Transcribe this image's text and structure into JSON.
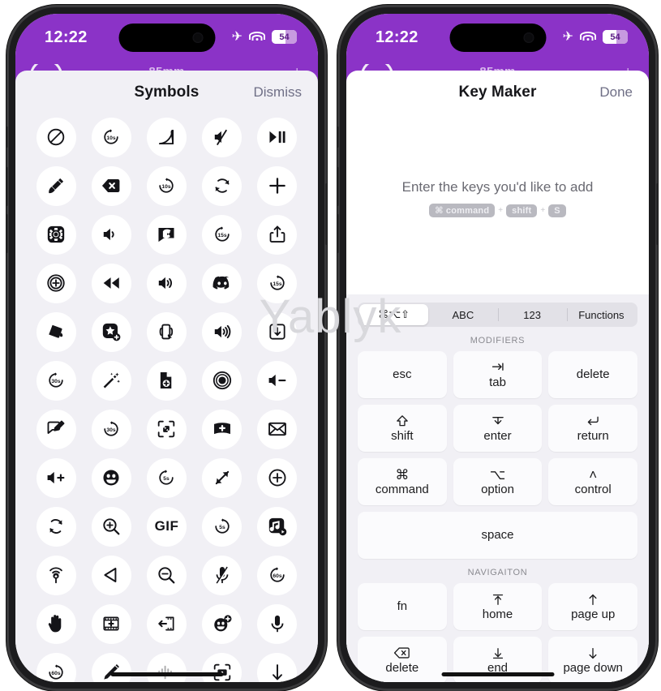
{
  "watermark": "Yablyk",
  "status_bar": {
    "time": "12:22",
    "airplane_icon": "airplane-mode-icon",
    "wifi_icon": "wifi-icon",
    "battery_level": "54",
    "battery_percent": 54,
    "bar_color": "#8B33C7"
  },
  "app_behind": {
    "title": "85mm",
    "back_icon": "circle-icon",
    "right_label": "|"
  },
  "left_phone": {
    "sheet": {
      "title": "Symbols",
      "action_label": "Dismiss"
    },
    "symbols": [
      {
        "name": "slash-circle-icon",
        "label": "nosign"
      },
      {
        "name": "goback-10-seconds-icon",
        "label": "10s"
      },
      {
        "name": "curve-chart-icon",
        "label": "curve"
      },
      {
        "name": "speaker-slash-icon",
        "label": "mute"
      },
      {
        "name": "play-pause-icon",
        "label": "play/pause"
      },
      {
        "name": "pen-plug-icon",
        "label": "pen"
      },
      {
        "name": "delete-left-x-icon",
        "label": "delete"
      },
      {
        "name": "goforward-10-seconds-icon",
        "label": "10s"
      },
      {
        "name": "arrow-triangle-2-circlepath-icon",
        "label": "loop"
      },
      {
        "name": "plus-icon",
        "label": "plus"
      },
      {
        "name": "gearshape-square-icon",
        "label": "settings"
      },
      {
        "name": "speaker-wave-1-icon",
        "label": "volume low"
      },
      {
        "name": "phone-bubble-icon",
        "label": "call bubble"
      },
      {
        "name": "goback-15-seconds-icon",
        "label": "15s"
      },
      {
        "name": "square-and-arrow-up-icon",
        "label": "share"
      },
      {
        "name": "plus-circle-dotted-icon",
        "label": "add circle"
      },
      {
        "name": "backward-fill-icon",
        "label": "rewind"
      },
      {
        "name": "speaker-wave-2-icon",
        "label": "volume mid"
      },
      {
        "name": "discord-icon",
        "label": "discord"
      },
      {
        "name": "goforward-15-seconds-icon",
        "label": "15s"
      },
      {
        "name": "paintbucket-icon",
        "label": "fill"
      },
      {
        "name": "star-square-plus-icon",
        "label": "add favorite"
      },
      {
        "name": "rotate-device-icon",
        "label": "rotate"
      },
      {
        "name": "speaker-wave-3-icon",
        "label": "volume high"
      },
      {
        "name": "square-arrow-down-icon",
        "label": "download"
      },
      {
        "name": "goback-30-seconds-icon",
        "label": "30s"
      },
      {
        "name": "wand-and-stars-icon",
        "label": "magic"
      },
      {
        "name": "doc-badge-plus-icon",
        "label": "new doc"
      },
      {
        "name": "record-circle-icon",
        "label": "record"
      },
      {
        "name": "speaker-minus-icon",
        "label": "volume down"
      },
      {
        "name": "bubble-pencil-icon",
        "label": "edit comment"
      },
      {
        "name": "goforward-30-seconds-icon",
        "label": "30s"
      },
      {
        "name": "expand-corners-icon",
        "label": "expand"
      },
      {
        "name": "panorama-plus-icon",
        "label": "panorama"
      },
      {
        "name": "envelope-icon",
        "label": "mail"
      },
      {
        "name": "speaker-plus-icon",
        "label": "volume up"
      },
      {
        "name": "smiley-circle-icon",
        "label": "emoji"
      },
      {
        "name": "goback-5-seconds-icon",
        "label": "5s"
      },
      {
        "name": "arrow-up-left-down-right-icon",
        "label": "resize"
      },
      {
        "name": "plus-circle-outline-icon",
        "label": "add"
      },
      {
        "name": "arrow-2-circlepath-icon",
        "label": "refresh"
      },
      {
        "name": "magnify-plus-icon",
        "label": "zoom in"
      },
      {
        "name": "gif-icon",
        "label": "GIF"
      },
      {
        "name": "goforward-5-seconds-icon",
        "label": "5s"
      },
      {
        "name": "music-note-play-icon",
        "label": "music"
      },
      {
        "name": "airplay-audio-icon",
        "label": "airplay"
      },
      {
        "name": "play-left-triangle-icon",
        "label": "previous"
      },
      {
        "name": "magnify-minus-icon",
        "label": "zoom out"
      },
      {
        "name": "mic-slash-icon",
        "label": "mic off"
      },
      {
        "name": "goback-60-seconds-icon",
        "label": "60s"
      },
      {
        "name": "hand-raised-icon",
        "label": "stop hand"
      },
      {
        "name": "film-plus-icon",
        "label": "add clip"
      },
      {
        "name": "film-arrow-left-icon",
        "label": "export clip"
      },
      {
        "name": "smiley-plus-icon",
        "label": "add sticker"
      },
      {
        "name": "mic-icon",
        "label": "microphone"
      },
      {
        "name": "goforward-60-seconds-icon",
        "label": "60s"
      },
      {
        "name": "pencil-tip-icon",
        "label": "pencil"
      },
      {
        "name": "waveform-icon",
        "label": "waveform"
      },
      {
        "name": "camera-viewfinder-icon",
        "label": "camera"
      },
      {
        "name": "arrow-down-icon",
        "label": "down"
      }
    ]
  },
  "right_phone": {
    "sheet": {
      "title": "Key Maker",
      "action_label": "Done"
    },
    "prompt": "Enter the keys you'd like to add",
    "key_badges": [
      {
        "glyph": "⌘",
        "label": "command"
      },
      {
        "glyph": "",
        "label": "shift"
      },
      {
        "glyph": "",
        "label": "S"
      }
    ],
    "badge_separator": "+",
    "segments": [
      {
        "label": "⌘⌥⇧",
        "active": true
      },
      {
        "label": "ABC",
        "active": false
      },
      {
        "label": "123",
        "active": false
      },
      {
        "label": "Functions",
        "active": false
      }
    ],
    "sections": [
      {
        "title": "MODIFIERS",
        "rows": [
          [
            {
              "glyph": "",
              "label": "esc",
              "icon": ""
            },
            {
              "glyph": "",
              "label": "tab",
              "icon": "tab-arrow-icon"
            },
            {
              "glyph": "",
              "label": "delete",
              "icon": ""
            }
          ],
          [
            {
              "glyph": "",
              "label": "shift",
              "icon": "shift-arrow-icon"
            },
            {
              "glyph": "",
              "label": "enter",
              "icon": "enter-arrow-icon"
            },
            {
              "glyph": "",
              "label": "return",
              "icon": "return-arrow-icon"
            }
          ],
          [
            {
              "glyph": "⌘",
              "label": "command",
              "icon": ""
            },
            {
              "glyph": "⌥",
              "label": "option",
              "icon": ""
            },
            {
              "glyph": "˄",
              "label": "control",
              "icon": ""
            }
          ],
          [
            {
              "glyph": "",
              "label": "space",
              "icon": "",
              "wide": true
            }
          ]
        ]
      },
      {
        "title": "NAVIGAITON",
        "rows": [
          [
            {
              "glyph": "",
              "label": "fn",
              "icon": ""
            },
            {
              "glyph": "",
              "label": "home",
              "icon": "home-arrow-icon"
            },
            {
              "glyph": "",
              "label": "page up",
              "icon": "arrow-up-icon"
            }
          ],
          [
            {
              "glyph": "",
              "label": "delete",
              "icon": "delete-left-icon"
            },
            {
              "glyph": "",
              "label": "end",
              "icon": "end-arrow-icon"
            },
            {
              "glyph": "",
              "label": "page down",
              "icon": "arrow-down-icon"
            }
          ]
        ]
      }
    ]
  }
}
